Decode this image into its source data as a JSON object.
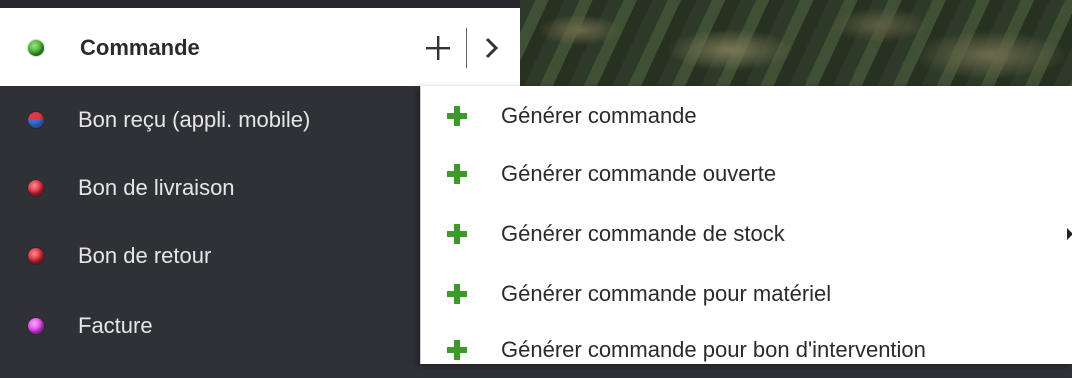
{
  "colors": {
    "header_dot": "#3fae2a",
    "accent_plus": "#3c9a2a"
  },
  "header": {
    "title": "Commande",
    "add_icon": "plus-icon",
    "next_icon": "chevron-right-icon"
  },
  "sidebar": {
    "items": [
      {
        "label": "Bon reçu (appli. mobile)",
        "dot_color": "#d9344a",
        "dot_color2": "#3b6fd6"
      },
      {
        "label": "Bon de livraison",
        "dot_color": "#d3243a"
      },
      {
        "label": "Bon de retour",
        "dot_color": "#d3243a"
      },
      {
        "label": "Facture",
        "dot_color": "#e040e8"
      }
    ]
  },
  "menu": {
    "items": [
      {
        "label": "Générer commande",
        "has_submenu": false
      },
      {
        "label": "Générer commande ouverte",
        "has_submenu": false
      },
      {
        "label": "Générer commande de stock",
        "has_submenu": true
      },
      {
        "label": "Générer commande pour matériel",
        "has_submenu": false
      },
      {
        "label": "Générer commande pour bon d'intervention",
        "has_submenu": false
      }
    ]
  }
}
